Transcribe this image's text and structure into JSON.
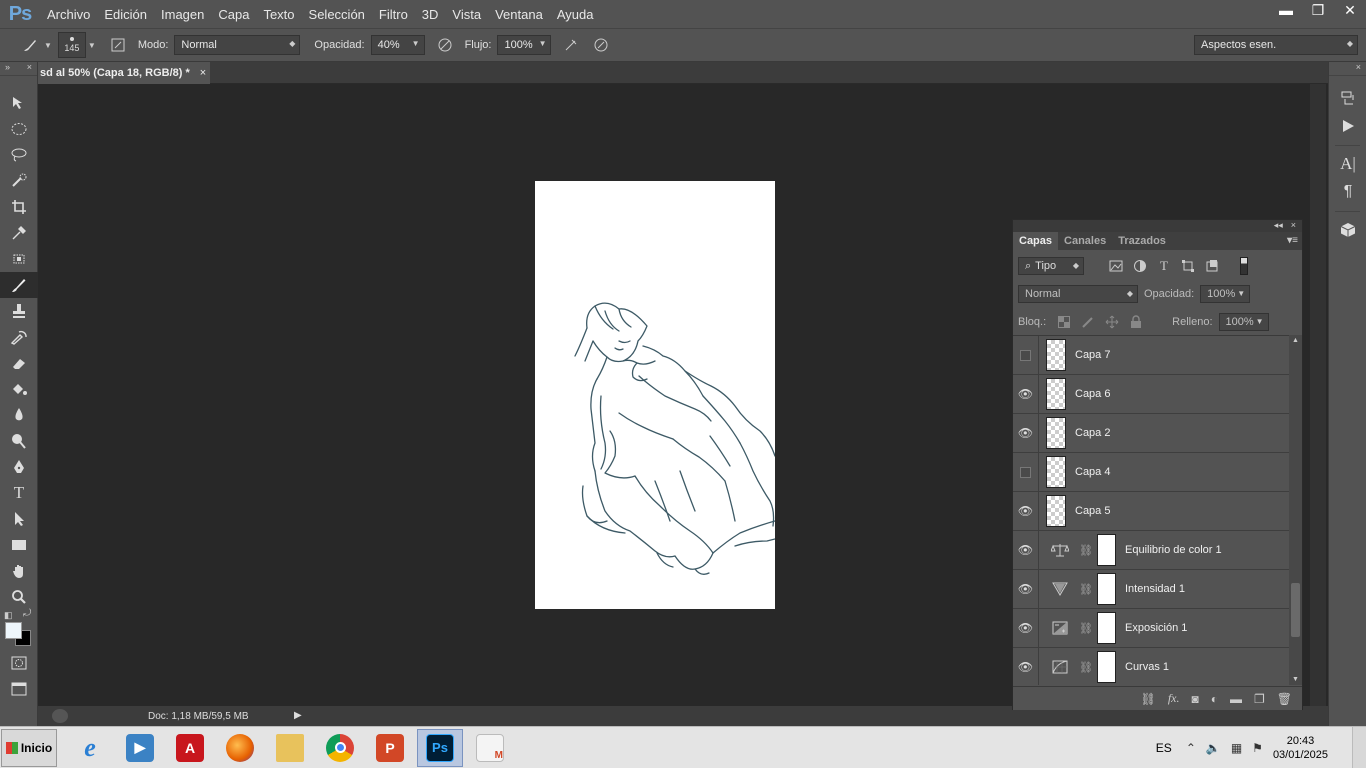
{
  "app": {
    "logo": "Ps"
  },
  "menu": [
    "Archivo",
    "Edición",
    "Imagen",
    "Capa",
    "Texto",
    "Selección",
    "Filtro",
    "3D",
    "Vista",
    "Ventana",
    "Ayuda"
  ],
  "window_controls": {
    "minimize": "▬",
    "restore": "❐",
    "close": "✕"
  },
  "options": {
    "brush_size": "145",
    "mode_label": "Modo:",
    "mode_value": "Normal",
    "opacity_label": "Opacidad:",
    "opacity_value": "40%",
    "flow_label": "Flujo:",
    "flow_value": "100%",
    "workspace": "Aspectos esen."
  },
  "document": {
    "tab_title": "sd al 50% (Capa 18, RGB/8) *",
    "tab_close": "×",
    "status": "Doc: 1,18 MB/59,5 MB"
  },
  "layers_panel": {
    "tabs": [
      "Capas",
      "Canales",
      "Trazados"
    ],
    "filter_kind": "Tipo",
    "blend_mode": "Normal",
    "opacity_label": "Opacidad:",
    "opacity_value": "100%",
    "lock_label": "Bloq.:",
    "fill_label": "Relleno:",
    "fill_value": "100%",
    "layers": [
      {
        "name": "Capa 7",
        "visible": false,
        "type": "pixel"
      },
      {
        "name": "Capa 6",
        "visible": true,
        "type": "pixel"
      },
      {
        "name": "Capa 2",
        "visible": true,
        "type": "pixel"
      },
      {
        "name": "Capa 4",
        "visible": false,
        "type": "pixel"
      },
      {
        "name": "Capa 5",
        "visible": true,
        "type": "pixel"
      },
      {
        "name": "Equilibrio de color 1",
        "visible": true,
        "type": "adjustment",
        "icon": "balance-icon"
      },
      {
        "name": "Intensidad 1",
        "visible": true,
        "type": "adjustment",
        "icon": "vibrance-icon"
      },
      {
        "name": "Exposición 1",
        "visible": true,
        "type": "adjustment",
        "icon": "exposure-icon"
      },
      {
        "name": "Curvas 1",
        "visible": true,
        "type": "adjustment",
        "icon": "curves-icon"
      }
    ]
  },
  "taskbar": {
    "start_label": "Inicio",
    "lang": "ES",
    "time": "20:43",
    "date": "03/01/2025"
  }
}
